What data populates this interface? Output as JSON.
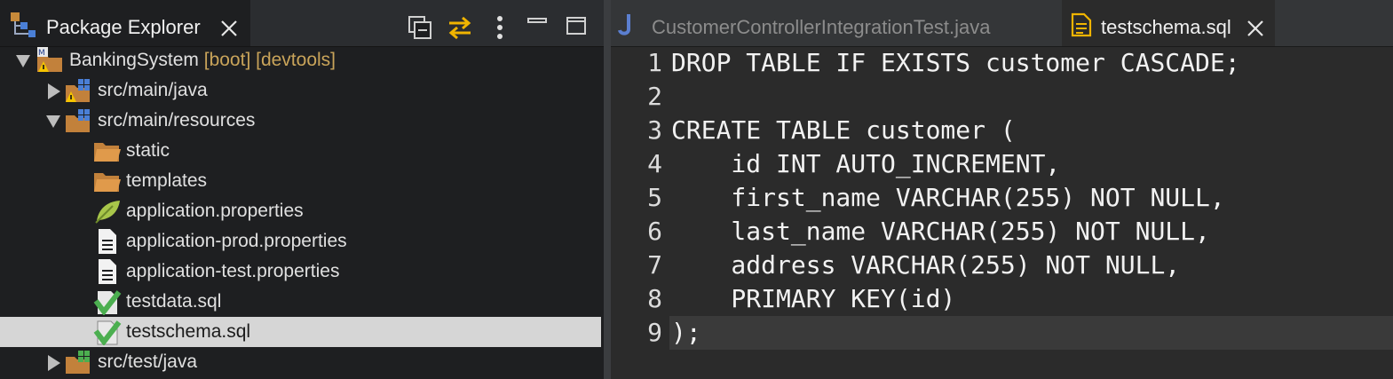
{
  "explorer": {
    "title": "Package Explorer",
    "tree": [
      {
        "label": "BankingSystem",
        "decoration": " [boot] [devtools]",
        "icon": "maven-project-warning-icon",
        "expanded": true
      },
      {
        "label": "src/main/java",
        "icon": "package-folder-warning-icon",
        "expanded": false
      },
      {
        "label": "src/main/resources",
        "icon": "package-folder-icon",
        "expanded": true
      },
      {
        "label": "static",
        "icon": "folder-icon"
      },
      {
        "label": "templates",
        "icon": "folder-icon"
      },
      {
        "label": "application.properties",
        "icon": "properties-leaf-icon"
      },
      {
        "label": "application-prod.properties",
        "icon": "text-file-icon"
      },
      {
        "label": "application-test.properties",
        "icon": "text-file-icon"
      },
      {
        "label": "testdata.sql",
        "icon": "sql-file-icon"
      },
      {
        "label": "testschema.sql",
        "icon": "sql-file-icon",
        "selected": true
      },
      {
        "label": "src/test/java",
        "icon": "package-folder-icon",
        "expanded": false
      }
    ]
  },
  "editor": {
    "tabs": [
      {
        "label": "CustomerControllerIntegrationTest.java",
        "icon": "java-file-icon",
        "active": false
      },
      {
        "label": "testschema.sql",
        "icon": "document-icon",
        "active": true
      }
    ],
    "lines": [
      "DROP TABLE IF EXISTS customer CASCADE;",
      "",
      "CREATE TABLE customer (",
      "    id INT AUTO_INCREMENT,",
      "    first_name VARCHAR(255) NOT NULL,",
      "    last_name VARCHAR(255) NOT NULL,",
      "    address VARCHAR(255) NOT NULL,",
      "    PRIMARY KEY(id)",
      ");"
    ],
    "line_numbers": [
      "1",
      "2",
      "3",
      "4",
      "5",
      "6",
      "7",
      "8",
      "9"
    ]
  },
  "colors": {
    "accent": "#f0b400",
    "selection": "#d6d6d6",
    "decoration": "#c9a45a"
  }
}
